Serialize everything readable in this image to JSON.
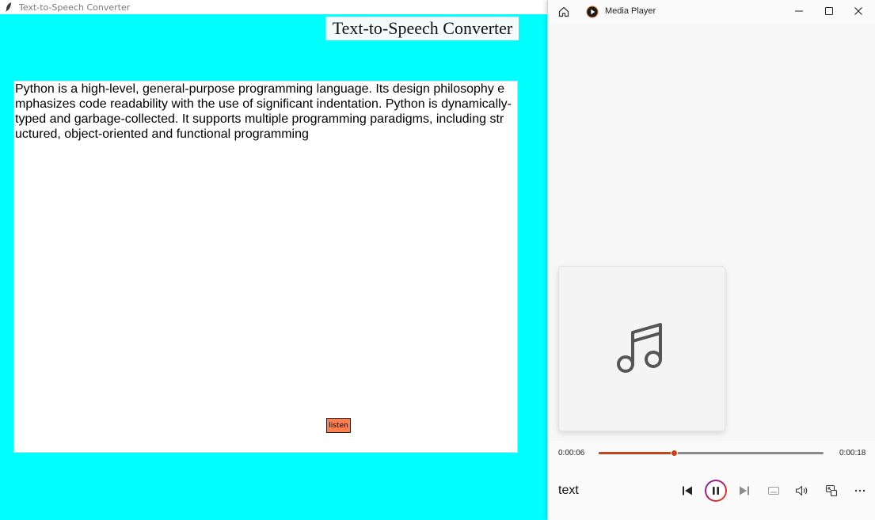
{
  "tk_window": {
    "title": "Text-to-Speech Converter",
    "heading": "Text-to-Speech Converter",
    "text_lines": [
      "Python is a high-level, general-purpose programming language. Its design philosophy e",
      "mphasizes code readability with the use of significant indentation. Python is dynamically-",
      "typed and garbage-collected. It supports multiple programming paradigms, including str",
      "uctured, object-oriented and functional programming"
    ],
    "listen_label": "listen",
    "colors": {
      "background": "#00ffff",
      "button": "#ff7f50"
    }
  },
  "media_player": {
    "title": "Media Player",
    "current_time": "0:00:06",
    "total_time": "0:00:18",
    "progress": 0.333,
    "track_title": "text",
    "art_icon": "music-note-icon",
    "colors": {
      "accent": "#c4441c"
    }
  }
}
